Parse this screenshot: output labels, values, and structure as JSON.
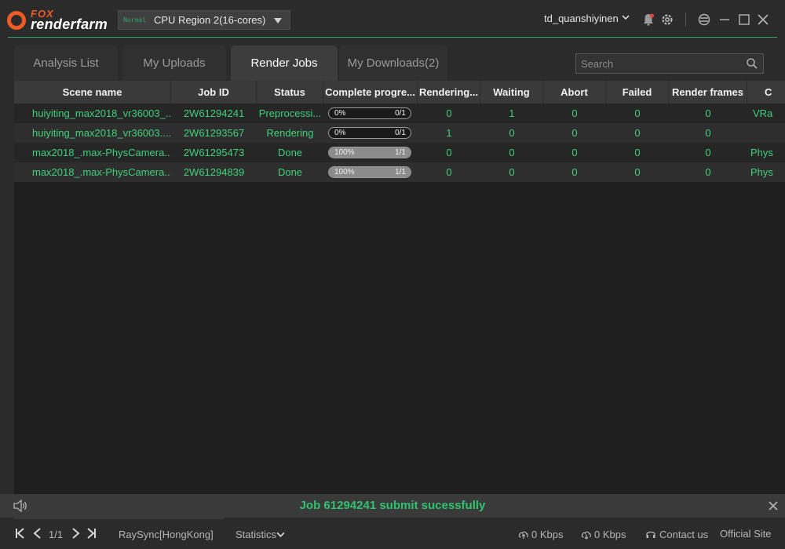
{
  "app": {
    "logo_top": "FOX",
    "logo_bottom": "renderfarm",
    "region": {
      "badge": "Normal",
      "label": "CPU Region 2(16-cores)"
    },
    "username": "td_quanshiyinen"
  },
  "tabs": [
    {
      "label": "Analysis List"
    },
    {
      "label": "My Uploads"
    },
    {
      "label": "Render Jobs"
    },
    {
      "label": "My Downloads(2)"
    }
  ],
  "search": {
    "placeholder": "Search"
  },
  "table": {
    "columns": [
      "Scene name",
      "Job ID",
      "Status",
      "Complete progre...",
      "Rendering...",
      "Waiting",
      "Abort",
      "Failed",
      "Render frames",
      "C"
    ],
    "rows": [
      {
        "scene": "huiyiting_max2018_vr36003_...",
        "job_id": "2W61294241",
        "status": "Preprocessi...",
        "pct": "0%",
        "progress": 0,
        "frames": "0/1",
        "rendering": "0",
        "waiting": "1",
        "abort": "0",
        "failed": "0",
        "render_frames": "0",
        "extra": "VRa"
      },
      {
        "scene": "huiyiting_max2018_vr36003....",
        "job_id": "2W61293567",
        "status": "Rendering",
        "pct": "0%",
        "progress": 0,
        "frames": "0/1",
        "rendering": "1",
        "waiting": "0",
        "abort": "0",
        "failed": "0",
        "render_frames": "0",
        "extra": ""
      },
      {
        "scene": "max2018_.max-PhysCamera...",
        "job_id": "2W61295473",
        "status": "Done",
        "pct": "100%",
        "progress": 1,
        "frames": "1/1",
        "rendering": "0",
        "waiting": "0",
        "abort": "0",
        "failed": "0",
        "render_frames": "0",
        "extra": "Phys"
      },
      {
        "scene": "max2018_.max-PhysCamera...",
        "job_id": "2W61294839",
        "status": "Done",
        "pct": "100%",
        "progress": 1,
        "frames": "1/1",
        "rendering": "0",
        "waiting": "0",
        "abort": "0",
        "failed": "0",
        "render_frames": "0",
        "extra": "Phys"
      }
    ]
  },
  "notification": {
    "message": "Job 61294241 submit sucessfully"
  },
  "footer": {
    "page": "1/1",
    "raysync": "RaySync[HongKong]",
    "statistics": "Statistics",
    "upload_speed": "0 Kbps",
    "download_speed": "0 Kbps",
    "contact": "Contact us",
    "official": "Official Site"
  }
}
